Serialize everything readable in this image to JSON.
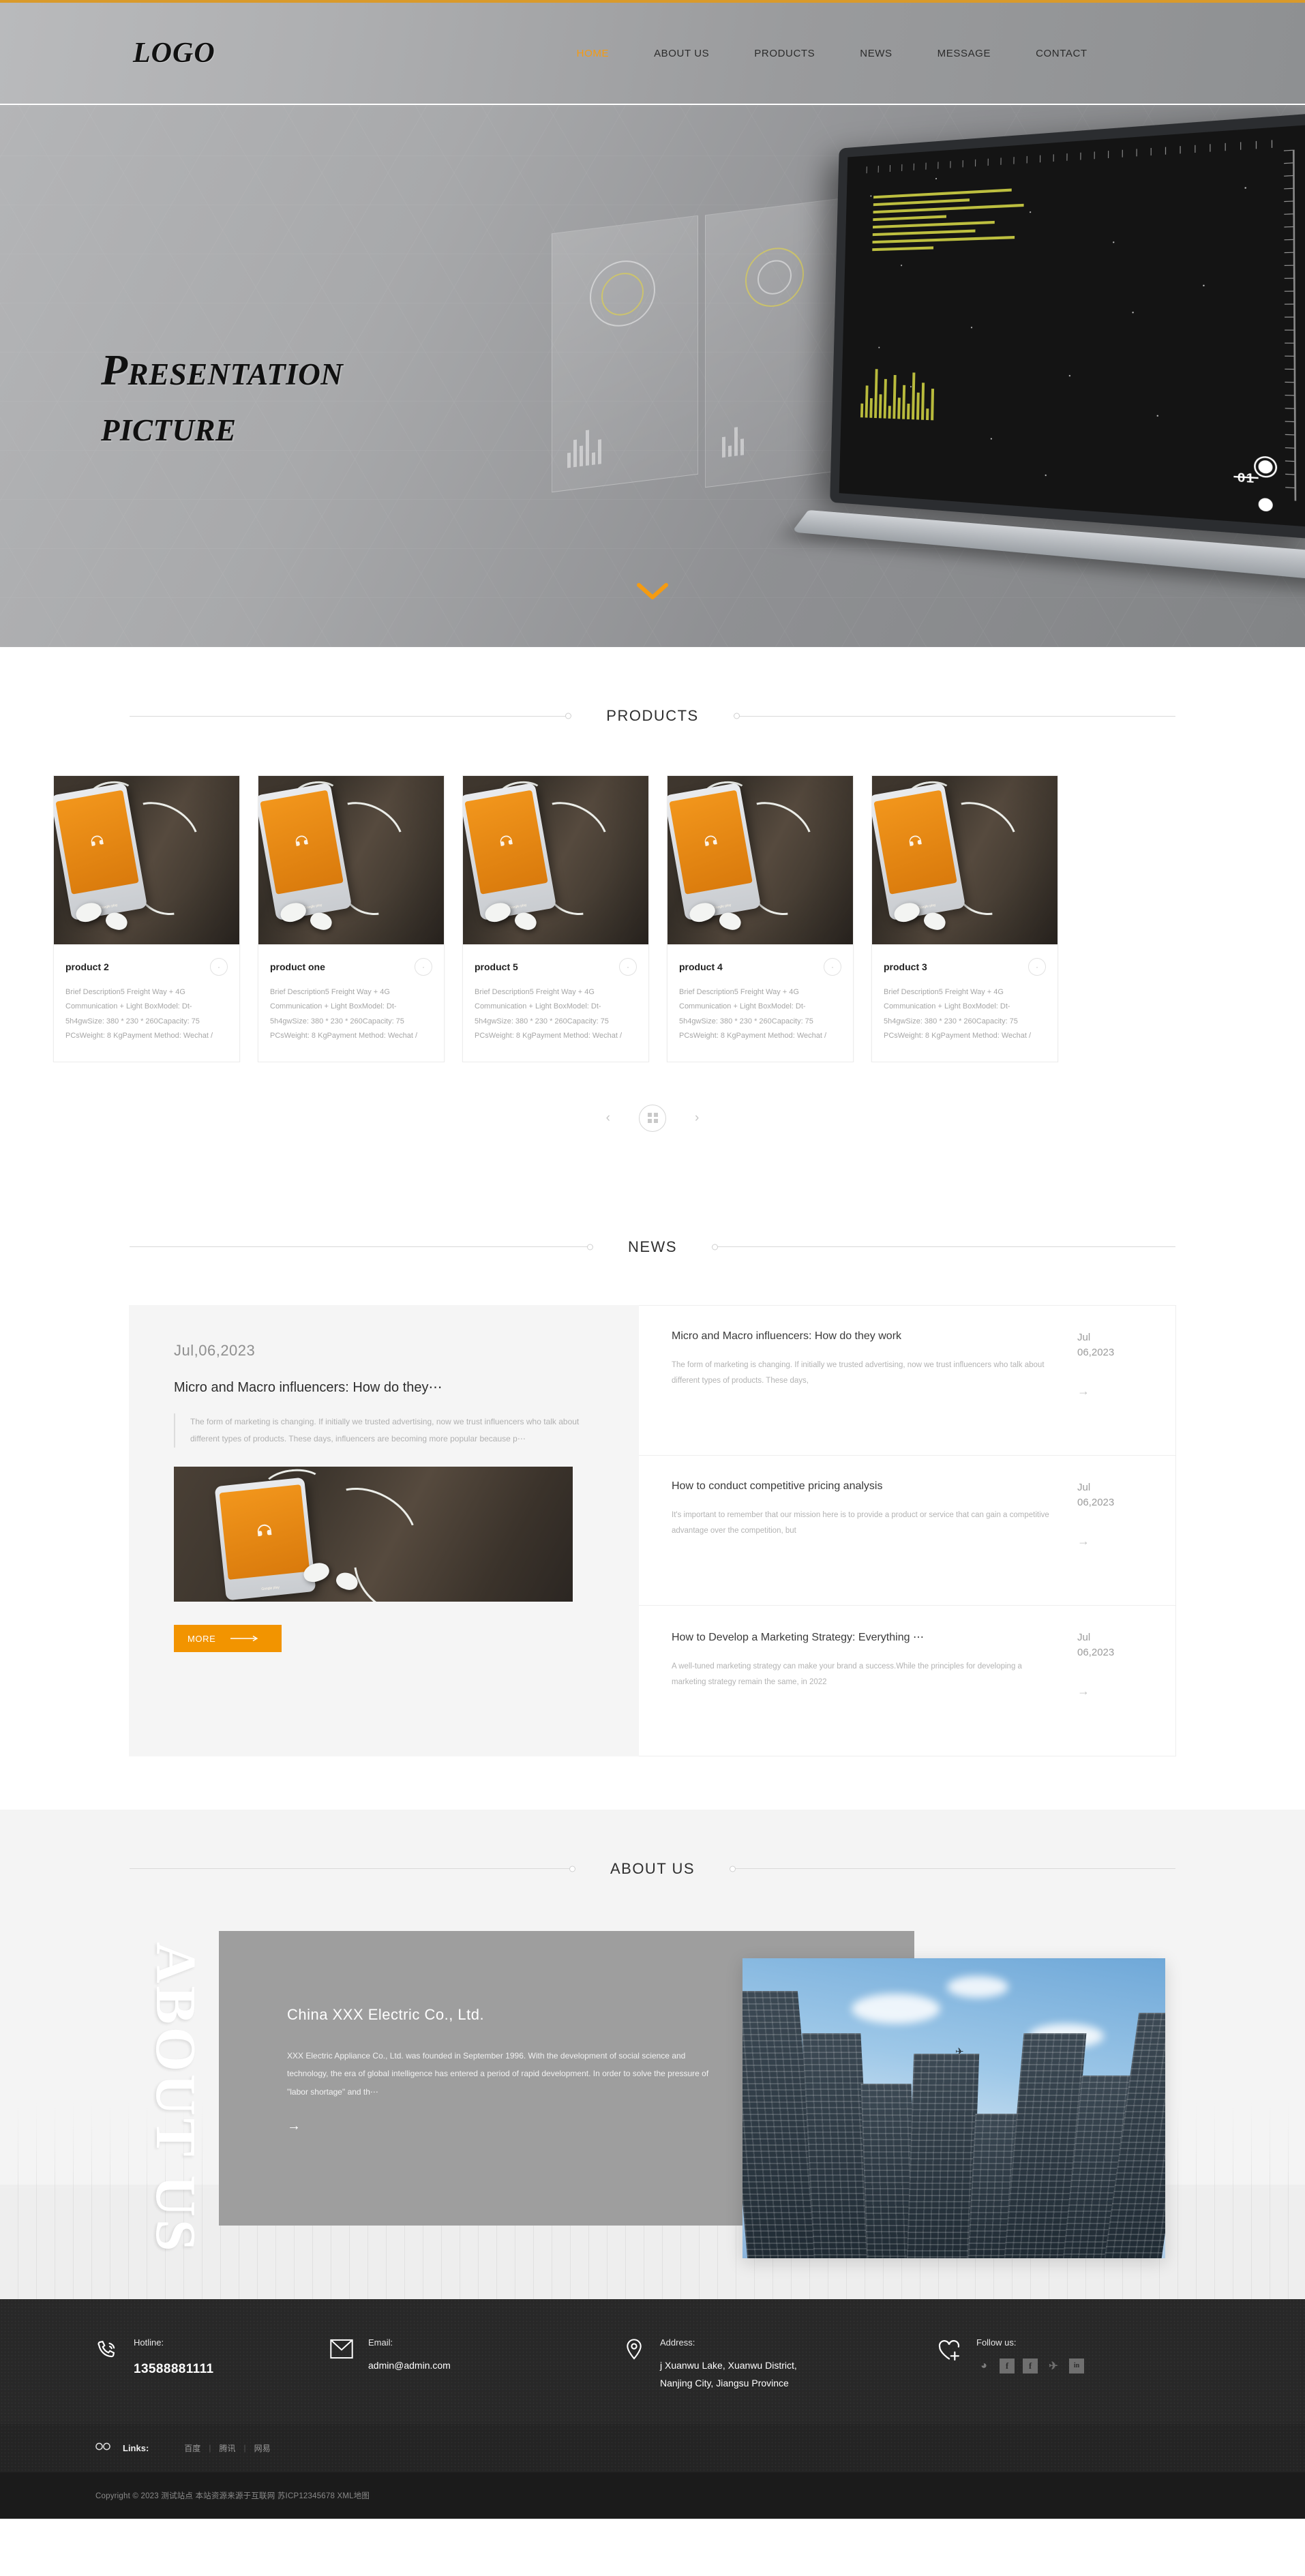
{
  "header": {
    "logo": "LOGO",
    "nav": [
      {
        "label": "HOME",
        "active": true
      },
      {
        "label": "ABOUT US",
        "active": false
      },
      {
        "label": "PRODUCTS",
        "active": false
      },
      {
        "label": "NEWS",
        "active": false
      },
      {
        "label": "MESSAGE",
        "active": false
      },
      {
        "label": "CONTACT",
        "active": false
      }
    ],
    "accent_color": "#d99a2b"
  },
  "hero": {
    "title_line1": "Presentation",
    "title_line2": "picture",
    "slide_number": "01",
    "scroll_icon": "chevron-down-icon",
    "scroll_color": "#f59b11"
  },
  "products": {
    "section_title": "PRODUCTS",
    "items": [
      {
        "name": "product 2",
        "description": "Brief Description5 Freight Way + 4G Communication + Light BoxModel: Dt-5h4gwSize: 380 * 230 * 260Capacity: 75 PCsWeight: 8 KgPayment Method: Wechat /"
      },
      {
        "name": "product one",
        "description": "Brief Description5 Freight Way + 4G Communication + Light BoxModel: Dt-5h4gwSize: 380 * 230 * 260Capacity: 75 PCsWeight: 8 KgPayment Method: Wechat /"
      },
      {
        "name": "product 5",
        "description": "Brief Description5 Freight Way + 4G Communication + Light BoxModel: Dt-5h4gwSize: 380 * 230 * 260Capacity: 75 PCsWeight: 8 KgPayment Method: Wechat /"
      },
      {
        "name": "product 4",
        "description": "Brief Description5 Freight Way + 4G Communication + Light BoxModel: Dt-5h4gwSize: 380 * 230 * 260Capacity: 75 PCsWeight: 8 KgPayment Method: Wechat /"
      },
      {
        "name": "product 3",
        "description": "Brief Description5 Freight Way + 4G Communication + Light BoxModel: Dt-5h4gwSize: 380 * 230 * 260Capacity: 75 PCsWeight: 8 KgPayment Method: Wechat /"
      }
    ],
    "carousel": {
      "prev": "‹",
      "next": "›",
      "grid_icon": "grid-icon"
    }
  },
  "news": {
    "section_title": "NEWS",
    "featured": {
      "date": "Jul,06,2023",
      "title": "Micro and Macro influencers: How do they⋯",
      "excerpt": "The form of marketing is changing. If initially we trusted advertising, now we trust influencers who talk about different types of products. These days, influencers are becoming more popular because p⋯",
      "more_label": "MORE",
      "more_color": "#f29400"
    },
    "items": [
      {
        "title": "Micro and Macro influencers: How do they work",
        "excerpt": "The form of marketing is changing. If initially we trusted advertising, now we trust influencers who talk about different types of products. These days,",
        "date_month": "Jul",
        "date_day": "06,2023",
        "arrow": "→"
      },
      {
        "title": "How to conduct competitive pricing analysis",
        "excerpt": "It's important to remember that our mission here is to provide a product or service that can gain a competitive advantage over the competition, but",
        "date_month": "Jul",
        "date_day": "06,2023",
        "arrow": "→"
      },
      {
        "title": "How to Develop a Marketing Strategy: Everything ⋯",
        "excerpt": "A well-tuned marketing strategy can make your brand a success.While the principles for developing a marketing strategy remain the same, in 2022",
        "date_month": "Jul",
        "date_day": "06,2023",
        "arrow": "→"
      }
    ]
  },
  "about": {
    "section_title": "ABOUT US",
    "watermark": "ABOUT US",
    "company": "China XXX Electric Co., Ltd.",
    "text": "XXX Electric Appliance Co., Ltd. was founded in September 1996. With the development of social science and technology, the era of global intelligence has entered a period of rapid development. In order to solve the pressure of \"labor shortage\" and th⋯",
    "arrow": "→"
  },
  "footer": {
    "hotline_label": "Hotline:",
    "hotline_value": "13588881111",
    "email_label": "Email:",
    "email_value": "admin@admin.com",
    "address_label": "Address:",
    "address_line1": "j Xuanwu Lake, Xuanwu District,",
    "address_line2": "Nanjing City, Jiangsu Province",
    "follow_label": "Follow us:",
    "socials": [
      {
        "name": "wechat-icon",
        "glyph": "◕"
      },
      {
        "name": "facebook-icon",
        "glyph": "f"
      },
      {
        "name": "facebook-alt-icon",
        "glyph": "f"
      },
      {
        "name": "twitter-icon",
        "glyph": "✈"
      },
      {
        "name": "linkedin-icon",
        "glyph": "in"
      }
    ],
    "links_label": "Links:",
    "links": [
      "百度",
      "腾讯",
      "网易"
    ],
    "link_sep": "|",
    "copyright": "Copyright © 2023 测试站点 本站资源来源于互联网 苏ICP12345678 XML地图"
  }
}
